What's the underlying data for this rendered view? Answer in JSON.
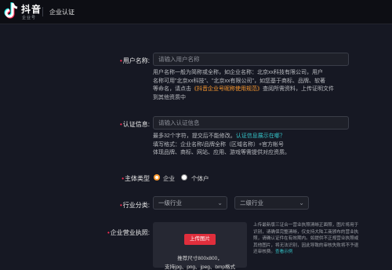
{
  "header": {
    "brand": "抖音",
    "brand_sub": "企业号",
    "nav_title": "企业认证"
  },
  "form": {
    "username": {
      "label": "用户名称:",
      "placeholder": "请输入用户名称",
      "hint_lines": [
        "用户名称一般为简称或全称，如企业名称：北京xx科技有限公司，用户",
        "名称可用\"北京xx科技\"、\"北京xx有限公司\"，如您基于商标、品牌、软著",
        "等命名，请点击"
      ],
      "hint_link": "《抖音企业号昵称使用规范》",
      "hint_after_link": "查阅所需资料，上传证明文件",
      "hint_last": "到其他资质中"
    },
    "certification": {
      "label": "认证信息:",
      "placeholder": "请输入认证信息",
      "hint_line1": "最多32个字符，提交后不能修改。",
      "hint_link": "认证信息展示在哪？",
      "hint_line2": "填写格式：企业名称/品牌全称（区域名称）+官方帐号",
      "hint_line3": "体现品牌、商标、网站、应用、游戏等需提供对应资质。"
    },
    "subject_type": {
      "label": "主体类型",
      "options": [
        "企业",
        "个体户"
      ],
      "selected": "企业"
    },
    "industry": {
      "label": "行业分类:",
      "primary": "一级行业",
      "secondary": "二级行业"
    },
    "license": {
      "label": "企业营业执照:",
      "upload_label": "上传图片",
      "size_hint": "推荐尺寸800x800，",
      "format_hint": "支持jpg、png、jpeg、bmp格式",
      "hint_text": "上传最新版三证合一营业执照清晰正面照，图片将用于识别，请确保完整清晰，仅支持大陆工商颁布的营业执照，请确认证件在有效期内。如提供不正规营业执照或其他图片，将无法识别，因此导致的审核失败将不予退还审核费。",
      "hint_link": "查看示例"
    }
  },
  "colors": {
    "accent": "#fe2c55",
    "highlight": "#fe9a2e",
    "link": "#34c3c8",
    "upload_button": "#e02e3c",
    "background": "#161823"
  }
}
